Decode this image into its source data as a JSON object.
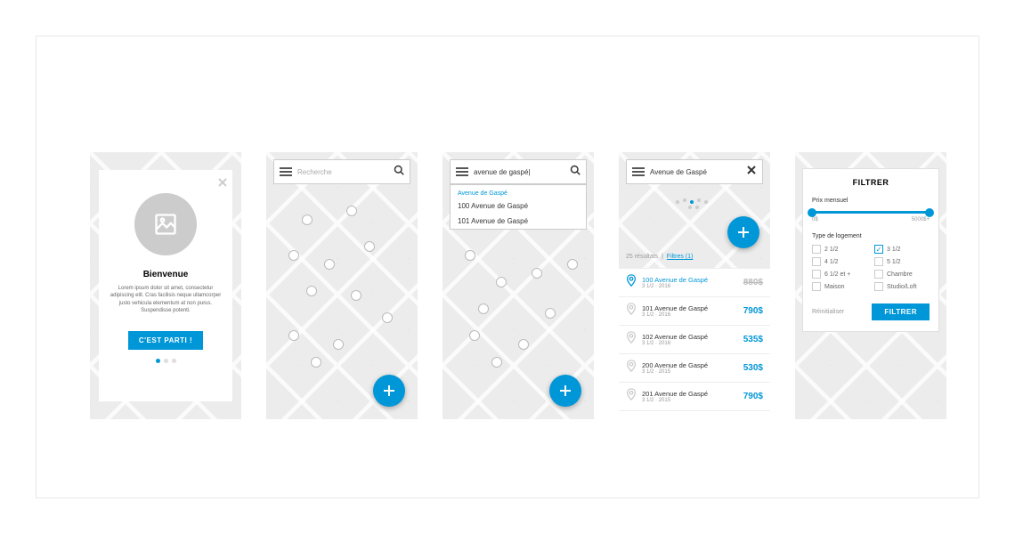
{
  "onboarding": {
    "title": "Bienvenue",
    "body": "Lorem ipsum dolor sit amet, consectetur adipiscing elit. Cras facilisis neque ullamcorper justo vehicula elementum at non purus. Suspendisse potenti.",
    "cta": "C'EST PARTI !"
  },
  "search": {
    "placeholder": "Recherche",
    "query": "avenue de gaspé|",
    "selected": "Avenue de Gaspé",
    "suggest_header": "Avenue de Gaspé",
    "suggestions": [
      "100 Avenue de Gaspé",
      "101 Avenue de Gaspé"
    ]
  },
  "results": {
    "count_label": "25 résultats",
    "filters_label": "Filtres (1)",
    "items": [
      {
        "title": "100 Avenue de Gaspé",
        "sub": "3 1/2 · 2016",
        "price": "880$",
        "highlight": true
      },
      {
        "title": "101 Avenue de Gaspé",
        "sub": "3 1/2 · 2016",
        "price": "790$"
      },
      {
        "title": "102 Avenue de Gaspé",
        "sub": "3 1/2 · 2016",
        "price": "535$"
      },
      {
        "title": "200 Avenue de Gaspé",
        "sub": "3 1/2 · 2015",
        "price": "530$"
      },
      {
        "title": "201 Avenue de Gaspé",
        "sub": "3 1/2 · 2015",
        "price": "790$"
      }
    ]
  },
  "filter": {
    "title": "FILTRER",
    "price_label": "Prix mensuel",
    "price_min": "0$",
    "price_max": "5000$+",
    "type_label": "Type de logement",
    "options": [
      {
        "label": "2 1/2"
      },
      {
        "label": "3 1/2",
        "checked": true
      },
      {
        "label": "4 1/2"
      },
      {
        "label": "5 1/2"
      },
      {
        "label": "6 1/2 et +"
      },
      {
        "label": "Chambre"
      },
      {
        "label": "Maison"
      },
      {
        "label": "Studio/Loft"
      }
    ],
    "reset": "Réinitialiser",
    "apply": "FILTRER"
  }
}
